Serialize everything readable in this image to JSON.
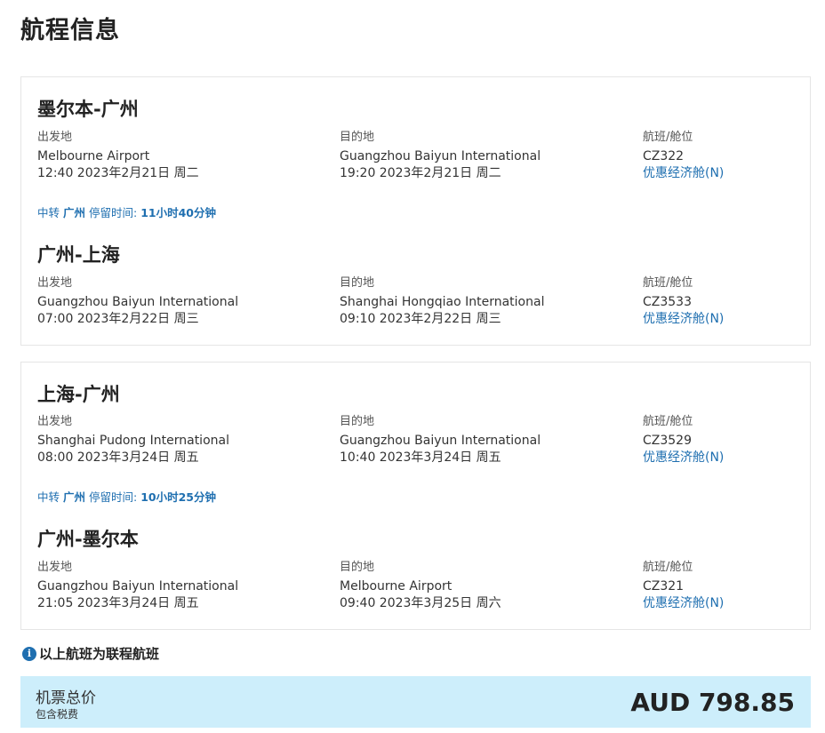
{
  "page": {
    "title": "航程信息"
  },
  "labels": {
    "depart": "出发地",
    "arrive": "目的地",
    "flight_cabin": "航班/舱位"
  },
  "outbound": {
    "seg1": {
      "title": "墨尔本-广州",
      "from_name": "Melbourne Airport",
      "from_time": "12:40 2023年2月21日 周二",
      "to_name": "Guangzhou Baiyun International",
      "to_time": "19:20 2023年2月21日 周二",
      "flight": "CZ322",
      "cabin": "优惠经济舱(N)"
    },
    "transfer": {
      "prefix": "中转",
      "city": "广州",
      "stay_label": "停留时间:",
      "duration": "11小时40分钟"
    },
    "seg2": {
      "title": "广州-上海",
      "from_name": "Guangzhou Baiyun International",
      "from_time": "07:00 2023年2月22日 周三",
      "to_name": "Shanghai Hongqiao International",
      "to_time": "09:10 2023年2月22日 周三",
      "flight": "CZ3533",
      "cabin": "优惠经济舱(N)"
    }
  },
  "return": {
    "seg1": {
      "title": "上海-广州",
      "from_name": "Shanghai Pudong International",
      "from_time": "08:00 2023年3月24日 周五",
      "to_name": "Guangzhou Baiyun International",
      "to_time": "10:40 2023年3月24日 周五",
      "flight": "CZ3529",
      "cabin": "优惠经济舱(N)"
    },
    "transfer": {
      "prefix": "中转",
      "city": "广州",
      "stay_label": "停留时间:",
      "duration": "10小时25分钟"
    },
    "seg2": {
      "title": "广州-墨尔本",
      "from_name": "Guangzhou Baiyun International",
      "from_time": "21:05 2023年3月24日 周五",
      "to_name": "Melbourne Airport",
      "to_time": "09:40 2023年3月25日 周六",
      "flight": "CZ321",
      "cabin": "优惠经济舱(N)"
    }
  },
  "notice": {
    "icon": "info-icon",
    "text": "以上航班为联程航班"
  },
  "price": {
    "label": "机票总价",
    "sub": "包含税费",
    "amount": "AUD 798.85"
  },
  "colors": {
    "accent": "#1f6fb0",
    "price_bg": "#cdeefb"
  }
}
